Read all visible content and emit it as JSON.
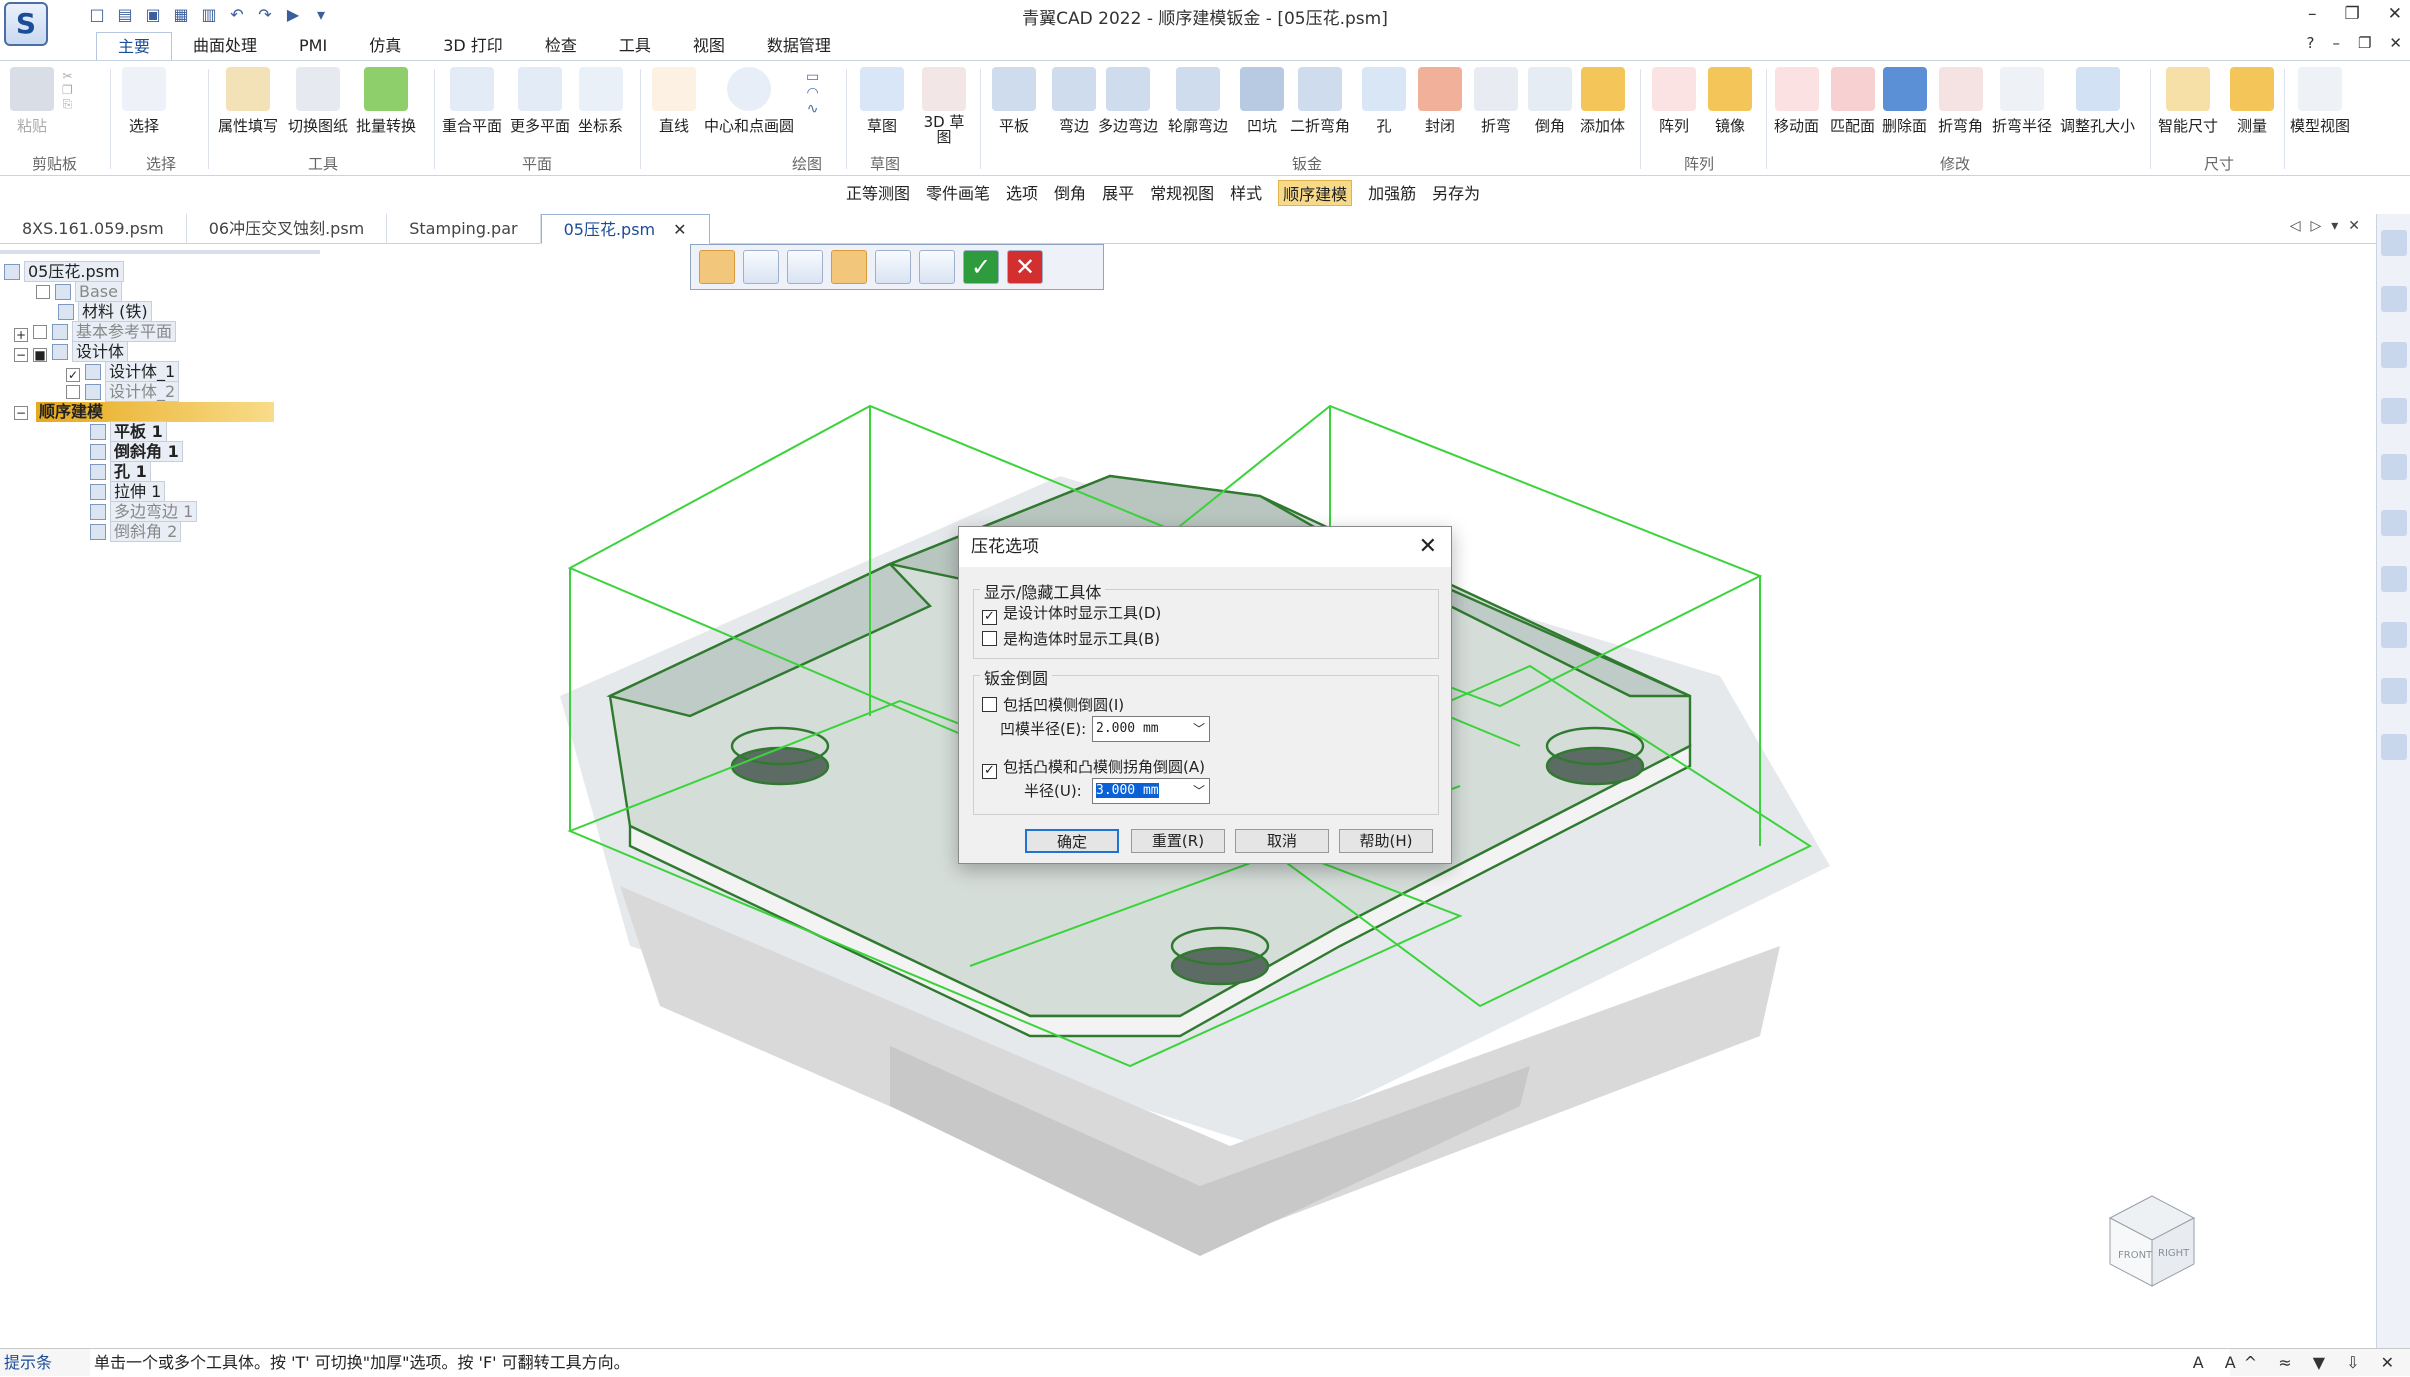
{
  "app": {
    "title": "青翼CAD 2022 - 顺序建模钣金 - [05压花.psm]",
    "logo_letter": "S",
    "window_controls": [
      "–",
      "❐",
      "✕"
    ],
    "doc_controls": [
      "?",
      "–",
      "❐",
      "✕"
    ]
  },
  "menu_tabs": [
    "主要",
    "曲面处理",
    "PMI",
    "仿真",
    "3D 打印",
    "检查",
    "工具",
    "视图",
    "数据管理"
  ],
  "ribbon": {
    "buttons": [
      "粘贴",
      "选择",
      "属性填写",
      "切换图纸",
      "批量转换",
      "重合平面",
      "更多平面",
      "坐标系",
      "直线",
      "中心和点画圆",
      "草图",
      "3D 草图",
      "平板",
      "弯边",
      "多边弯边",
      "轮廓弯边",
      "凹坑",
      "二折弯角",
      "孔",
      "封闭",
      "折弯",
      "倒角",
      "添加体",
      "阵列",
      "镜像",
      "移动面",
      "匹配面",
      "删除面",
      "折弯角",
      "折弯半径",
      "调整孔大小",
      "智能尺寸",
      "测量",
      "模型视图"
    ],
    "groups": [
      "剪贴板",
      "选择",
      "工具",
      "平面",
      "绘图",
      "草图",
      "钣金",
      "阵列",
      "修改",
      "尺寸"
    ]
  },
  "subbar": [
    "正等测图",
    "零件画笔",
    "选项",
    "倒角",
    "展平",
    "常规视图",
    "样式",
    "顺序建模",
    "加强筋",
    "另存为"
  ],
  "doc_tabs": [
    "8XS.161.059.psm",
    "06冲压交叉蚀刻.psm",
    "Stamping.par",
    "05压花.psm"
  ],
  "tree": {
    "nodes": [
      "05压花.psm",
      "Base",
      "材料 (铁)",
      "基本参考平面",
      "设计体",
      "设计体_1",
      "设计体_2",
      "顺序建模",
      "平板 1",
      "倒斜角 1",
      "孔 1",
      "拉伸 1",
      "多边弯边 1",
      "倒斜角 2"
    ]
  },
  "dialog": {
    "title": "压花选项",
    "group_display": "显示/隐藏工具体",
    "show_design_tool": "是设计体时显示工具(D)",
    "show_construct_tool": "是构造体时显示工具(B)",
    "group_round": "钣金倒圆",
    "include_die_round": "包括凹模侧倒圆(I)",
    "die_radius_label": "凹模半径(E):",
    "die_radius_value": "2.000 mm",
    "include_punch_round": "包括凸模和凸模侧拐角倒圆(A)",
    "radius_label": "半径(U):",
    "radius_value": "3.000 mm",
    "ok": "确定",
    "reset": "重置(R)",
    "cancel": "取消",
    "help": "帮助(H)"
  },
  "status": {
    "label": "提示条",
    "message": "单击一个或多个工具体。按 'T' 可切换\"加厚\"选项。按 'F' 可翻转工具方向。",
    "controls": "A A^ ≈ ▼ ⇩ ✕"
  },
  "viewcube": {
    "front": "FRONT",
    "right": "RIGHT"
  }
}
